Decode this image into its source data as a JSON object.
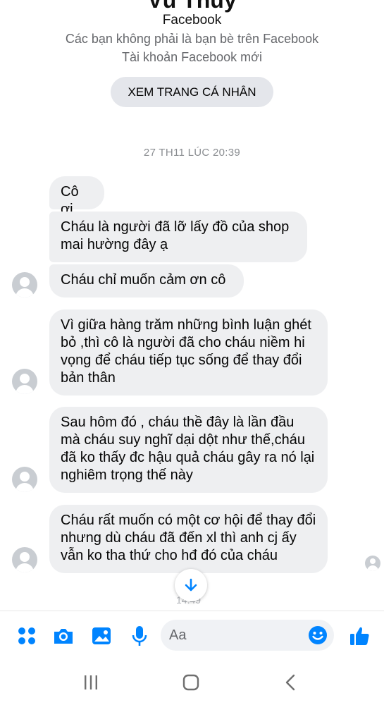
{
  "header": {
    "contact_name": "Vũ Thủy",
    "platform_label": "Facebook",
    "relation_status": "Các bạn không phải là bạn bè trên Facebook",
    "account_status": "Tài khoản Facebook mới",
    "view_profile_label": "XEM TRANG CÁ NHÂN"
  },
  "timestamp": "27 TH11 LÚC 20:39",
  "messages": [
    "Cô ơi",
    "Cháu là người đã lỡ lấy đồ của shop mai hường đây ạ",
    "Cháu chỉ muốn cảm ơn cô",
    "Vì giữa hàng trăm những bình luận ghét bỏ ,thì cô là người đã cho cháu niềm hi vọng để cháu tiếp tục sống để thay đổi bản thân",
    "Sau hôm đó , cháu thề đây là lần đầu mà cháu suy nghĩ dại dột như thế,cháu đã ko thấy đc hậu quả cháu gây ra nó lại nghiêm trọng thế này",
    "Cháu rất muốn có một cơ hội để thay đổi nhưng dù cháu đã đến xl thì anh cj ấy vẫn ko tha thứ cho hđ đó của cháu"
  ],
  "partial_time": "14:49",
  "composer": {
    "placeholder": "Aa"
  },
  "colors": {
    "accent": "#0084ff",
    "bubble": "#eeeff1"
  },
  "icons": [
    "menu-dots-icon",
    "camera-icon",
    "gallery-icon",
    "microphone-icon",
    "emoji-icon",
    "thumbs-up-icon",
    "recents-icon",
    "home-icon",
    "back-icon",
    "arrow-down-icon"
  ]
}
